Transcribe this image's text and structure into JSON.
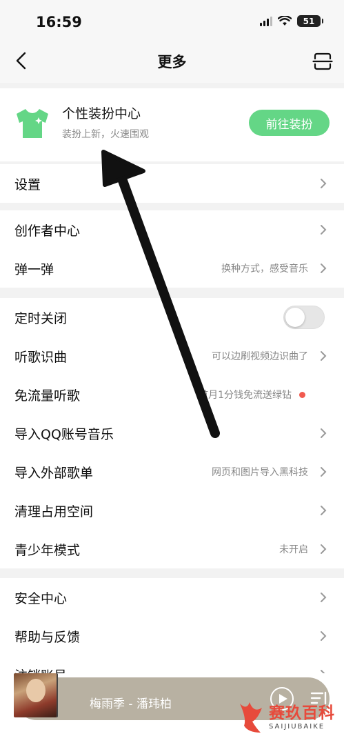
{
  "status_bar": {
    "time": "16:59",
    "battery": "51"
  },
  "nav": {
    "title": "更多"
  },
  "skin_card": {
    "title": "个性装扮中心",
    "subtitle": "装扮上新，火速围观",
    "button": "前往装扮",
    "accent": "#64d686"
  },
  "sections": [
    {
      "rows": [
        {
          "label": "设置",
          "value": ""
        }
      ]
    },
    {
      "rows": [
        {
          "label": "创作者中心",
          "value": ""
        },
        {
          "label": "弹一弹",
          "value": "换种方式，感受音乐"
        }
      ]
    },
    {
      "rows": [
        {
          "label": "定时关闭",
          "toggle": "off"
        },
        {
          "label": "听歌识曲",
          "value": "可以边刷视频边识曲了"
        },
        {
          "label": "免流量听歌",
          "value": "首月1分钱免流送绿钻",
          "dot": "#f15a4f"
        },
        {
          "label": "导入QQ账号音乐",
          "value": ""
        },
        {
          "label": "导入外部歌单",
          "value": "网页和图片导入黑科技"
        },
        {
          "label": "清理占用空间",
          "value": ""
        },
        {
          "label": "青少年模式",
          "value": "未开启"
        }
      ]
    },
    {
      "rows": [
        {
          "label": "安全中心",
          "value": ""
        },
        {
          "label": "帮助与反馈",
          "value": ""
        },
        {
          "label": "注销账号",
          "value": ""
        }
      ]
    }
  ],
  "player": {
    "track": "梅雨季 - 潘玮柏"
  },
  "watermark": {
    "brand": "赛玖百科",
    "sub": "SAIJIUBAIKE"
  }
}
